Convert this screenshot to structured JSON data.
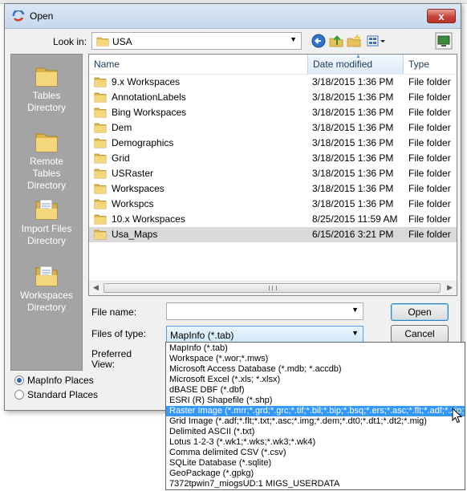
{
  "dialog": {
    "title": "Open",
    "close_glyph": "x"
  },
  "lookin": {
    "label": "Look in:",
    "value": "USA"
  },
  "toolbar": {
    "icons": [
      "back-icon",
      "up-folder-icon",
      "new-folder-icon",
      "view-menu-icon",
      "desktop-icon"
    ]
  },
  "places": [
    {
      "name": "Tables Directory",
      "l1": "Tables",
      "l2": "Directory"
    },
    {
      "name": "Remote Tables Directory",
      "l1": "Remote",
      "l2": "Tables",
      "l3": "Directory"
    },
    {
      "name": "Import Files Directory",
      "l1": "Import Files",
      "l2": "Directory"
    },
    {
      "name": "Workspaces Directory",
      "l1": "Workspaces",
      "l2": "Directory"
    }
  ],
  "columns": {
    "name": "Name",
    "date": "Date modified",
    "type": "Type"
  },
  "files": [
    {
      "name": "9.x Workspaces",
      "date": "3/18/2015 1:36 PM",
      "type": "File folder"
    },
    {
      "name": "AnnotationLabels",
      "date": "3/18/2015 1:36 PM",
      "type": "File folder"
    },
    {
      "name": "Bing Workspaces",
      "date": "3/18/2015 1:36 PM",
      "type": "File folder"
    },
    {
      "name": "Dem",
      "date": "3/18/2015 1:36 PM",
      "type": "File folder"
    },
    {
      "name": "Demographics",
      "date": "3/18/2015 1:36 PM",
      "type": "File folder"
    },
    {
      "name": "Grid",
      "date": "3/18/2015 1:36 PM",
      "type": "File folder"
    },
    {
      "name": "USRaster",
      "date": "3/18/2015 1:36 PM",
      "type": "File folder"
    },
    {
      "name": "Workspaces",
      "date": "3/18/2015 1:36 PM",
      "type": "File folder"
    },
    {
      "name": "Workspcs",
      "date": "3/18/2015 1:36 PM",
      "type": "File folder"
    },
    {
      "name": "10.x Workspaces",
      "date": "8/25/2015 11:59 AM",
      "type": "File folder"
    },
    {
      "name": "Usa_Maps",
      "date": "6/15/2016 3:21 PM",
      "type": "File folder"
    }
  ],
  "selected_file": "Usa_Maps",
  "filename": {
    "label": "File name:",
    "value": ""
  },
  "filetype": {
    "label": "Files of type:",
    "value": "MapInfo (*.tab)"
  },
  "preferred_view": {
    "l1": "Preferred",
    "l2": "View:"
  },
  "buttons": {
    "open": "Open",
    "cancel": "Cancel"
  },
  "radios": [
    {
      "label": "MapInfo Places",
      "checked": true
    },
    {
      "label": "Standard Places",
      "checked": false
    }
  ],
  "filetype_options": [
    "MapInfo (*.tab)",
    "Workspace (*.wor;*.mws)",
    "Microsoft Access Database (*.mdb; *.accdb)",
    "Microsoft Excel (*.xls; *.xlsx)",
    "dBASE DBF (*.dbf)",
    "ESRI (R) Shapefile (*.shp)",
    "Raster Image (*.mrr;*.grd;*.grc;*.tif;*.bil;*.bip;*.bsq;*.ers;*.asc;*.flt;*.adf;*.zip;*.img",
    "Grid Image (*.adf;*.flt;*.txt;*.asc;*.img;*.dem;*.dt0;*.dt1;*.dt2;*.mig)",
    "Delimited ASCII (*.txt)",
    "Lotus 1-2-3 (*.wk1;*.wks;*.wk3;*.wk4)",
    "Comma delimited CSV (*.csv)",
    "SQLite Database (*.sqlite)",
    "GeoPackage (*.gpkg)",
    "7372tpwin7_miogsUD:1 MIGS_USERDATA"
  ],
  "highlighted_option": 6,
  "colors": {
    "highlight": "#3399ff",
    "places_bg": "#a4a4a4",
    "selected_row": "#d9d9d9"
  }
}
